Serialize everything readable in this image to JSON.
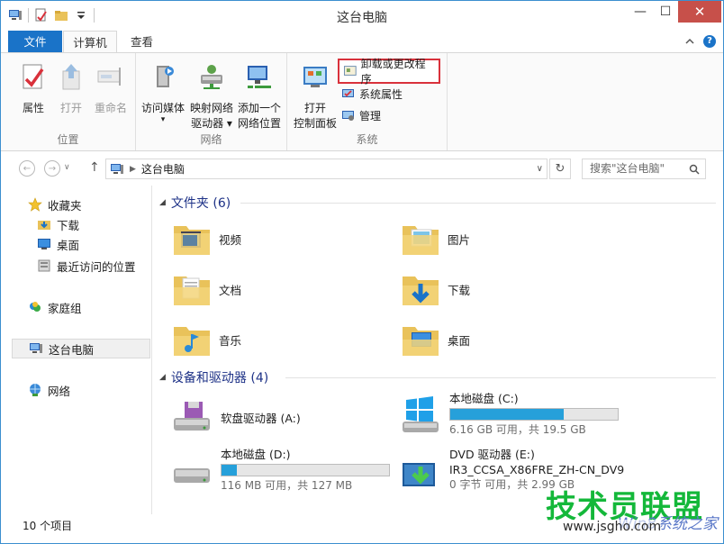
{
  "window": {
    "title": "这台电脑"
  },
  "window_buttons": {
    "minimize": "—",
    "maximize": "☐",
    "close": "✕"
  },
  "ribbon_tabs": {
    "file": "文件",
    "computer": "计算机",
    "view": "查看"
  },
  "ribbon": {
    "location": {
      "label": "位置",
      "properties": "属性",
      "open": "打开",
      "rename": "重命名"
    },
    "network": {
      "label": "网络",
      "access_media_line1": "访问媒体",
      "access_media_line2": "▾",
      "map_drive_line1": "映射网络",
      "map_drive_line2": "驱动器 ▾",
      "add_location_line1": "添加一个",
      "add_location_line2": "网络位置"
    },
    "system": {
      "label": "系统",
      "control_panel_line1": "打开",
      "control_panel_line2": "控制面板",
      "uninstall": "卸载或更改程序",
      "system_properties": "系统属性",
      "manage": "管理"
    }
  },
  "address": {
    "back": "←",
    "forward": "→",
    "up": "↑",
    "crumb_sep": "▶",
    "crumb": "这台电脑",
    "dropdown": "∨",
    "refresh": "↻",
    "search_placeholder": "搜索\"这台电脑\""
  },
  "nav_pane": {
    "favorites": "收藏夹",
    "downloads": "下载",
    "desktop": "桌面",
    "recent": "最近访问的位置",
    "homegroup": "家庭组",
    "this_pc": "这台电脑",
    "network": "网络"
  },
  "content": {
    "folders_header": "文件夹 (6)",
    "folders": [
      "视频",
      "图片",
      "文档",
      "下载",
      "音乐",
      "桌面"
    ],
    "devices_header": "设备和驱动器 (4)",
    "drives": [
      {
        "name": "软盘驱动器 (A:)",
        "sub": ""
      },
      {
        "name": "本地磁盘 (C:)",
        "sub": "6.16 GB 可用，共 19.5 GB",
        "used_fraction": 0.68
      },
      {
        "name": "本地磁盘 (D:)",
        "sub": "116 MB 可用，共 127 MB",
        "used_fraction": 0.09
      },
      {
        "name": "DVD 驱动器 (E:)",
        "sub2": "IR3_CCSA_X86FRE_ZH-CN_DV9",
        "sub": "0 字节 可用，共 2.99 GB"
      }
    ]
  },
  "status": {
    "count": "10 个项目"
  },
  "watermark": {
    "title": "技术员联盟",
    "sub": "Win8系统之家",
    "url": "www.jsgho.com"
  },
  "colors": {
    "accent": "#1a73c8",
    "drive_bar": "#26a0da",
    "highlight": "#d9313b",
    "watermark": "#14b83a"
  }
}
